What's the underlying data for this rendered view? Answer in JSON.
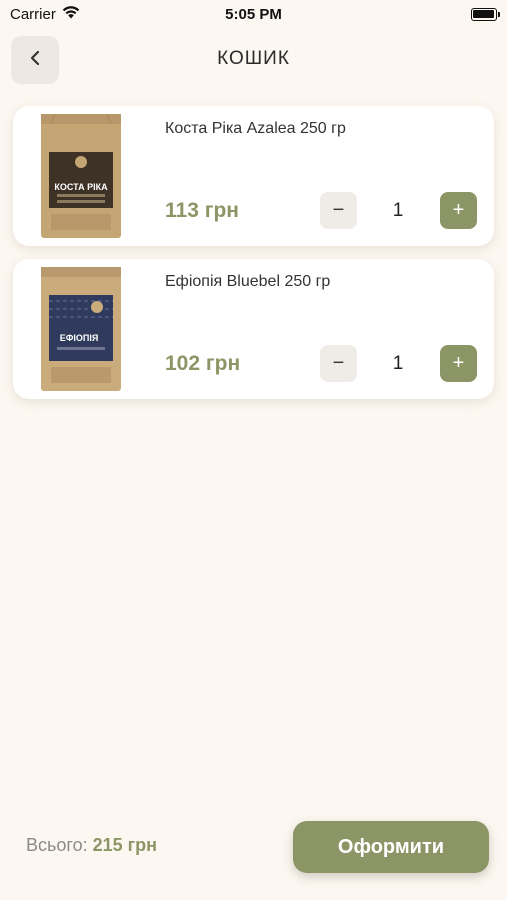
{
  "status_bar": {
    "carrier": "Carrier",
    "time": "5:05 PM",
    "icons": [
      "wifi-icon",
      "battery-icon"
    ]
  },
  "header": {
    "back_icon": "chevron-left-icon",
    "title": "КОШИК"
  },
  "cart": {
    "items": [
      {
        "name": "Коста Ріка Azalea 250 гр",
        "price": "113 грн",
        "quantity": "1",
        "minus_label": "−",
        "plus_label": "+",
        "package_label": "КОСТА РІКА",
        "package_color": "#4a3a2a"
      },
      {
        "name": "Ефіопія Bluebel 250 гр",
        "price": "102 грн",
        "quantity": "1",
        "minus_label": "−",
        "plus_label": "+",
        "package_label": "ЕФІОПІЯ",
        "package_color": "#2f3a5c"
      }
    ]
  },
  "footer": {
    "total_label": "Всього:",
    "total_value": "215 грн",
    "checkout_label": "Оформити"
  },
  "colors": {
    "background": "#fcf7f1",
    "accent": "#8c9566",
    "card": "#ffffff",
    "minus_button": "#efebe6"
  }
}
